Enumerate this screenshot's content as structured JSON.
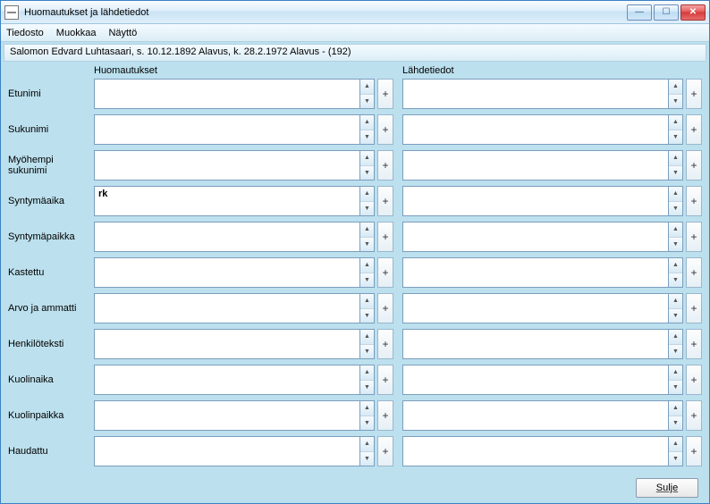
{
  "window": {
    "title": "Huomautukset ja lähdetiedot"
  },
  "menubar": {
    "file": "Tiedosto",
    "edit": "Muokkaa",
    "view": "Näyttö"
  },
  "context": "Salomon Edvard Luhtasaari,  s. 10.12.1892 Alavus, k. 28.2.1972 Alavus - (192)",
  "columns": {
    "notes": "Huomautukset",
    "sources": "Lähdetiedot"
  },
  "rows": [
    {
      "label": "Etunimi",
      "notes": "",
      "sources": ""
    },
    {
      "label": "Sukunimi",
      "notes": "",
      "sources": ""
    },
    {
      "label": "Myöhempi sukunimi",
      "notes": "",
      "sources": ""
    },
    {
      "label": "Syntymäaika",
      "notes": "rk",
      "sources": ""
    },
    {
      "label": "Syntymäpaikka",
      "notes": "",
      "sources": ""
    },
    {
      "label": "Kastettu",
      "notes": "",
      "sources": ""
    },
    {
      "label": "Arvo ja ammatti",
      "notes": "",
      "sources": ""
    },
    {
      "label": "Henkilöteksti",
      "notes": "",
      "sources": ""
    },
    {
      "label": "Kuolinaika",
      "notes": "",
      "sources": ""
    },
    {
      "label": "Kuolinpaikka",
      "notes": "",
      "sources": ""
    },
    {
      "label": "Haudattu",
      "notes": "",
      "sources": ""
    }
  ],
  "footer": {
    "close": "Sulje"
  },
  "glyphs": {
    "plus": "+",
    "up": "▲",
    "down": "▼",
    "min": "—",
    "max": "☐",
    "x": "✕"
  }
}
